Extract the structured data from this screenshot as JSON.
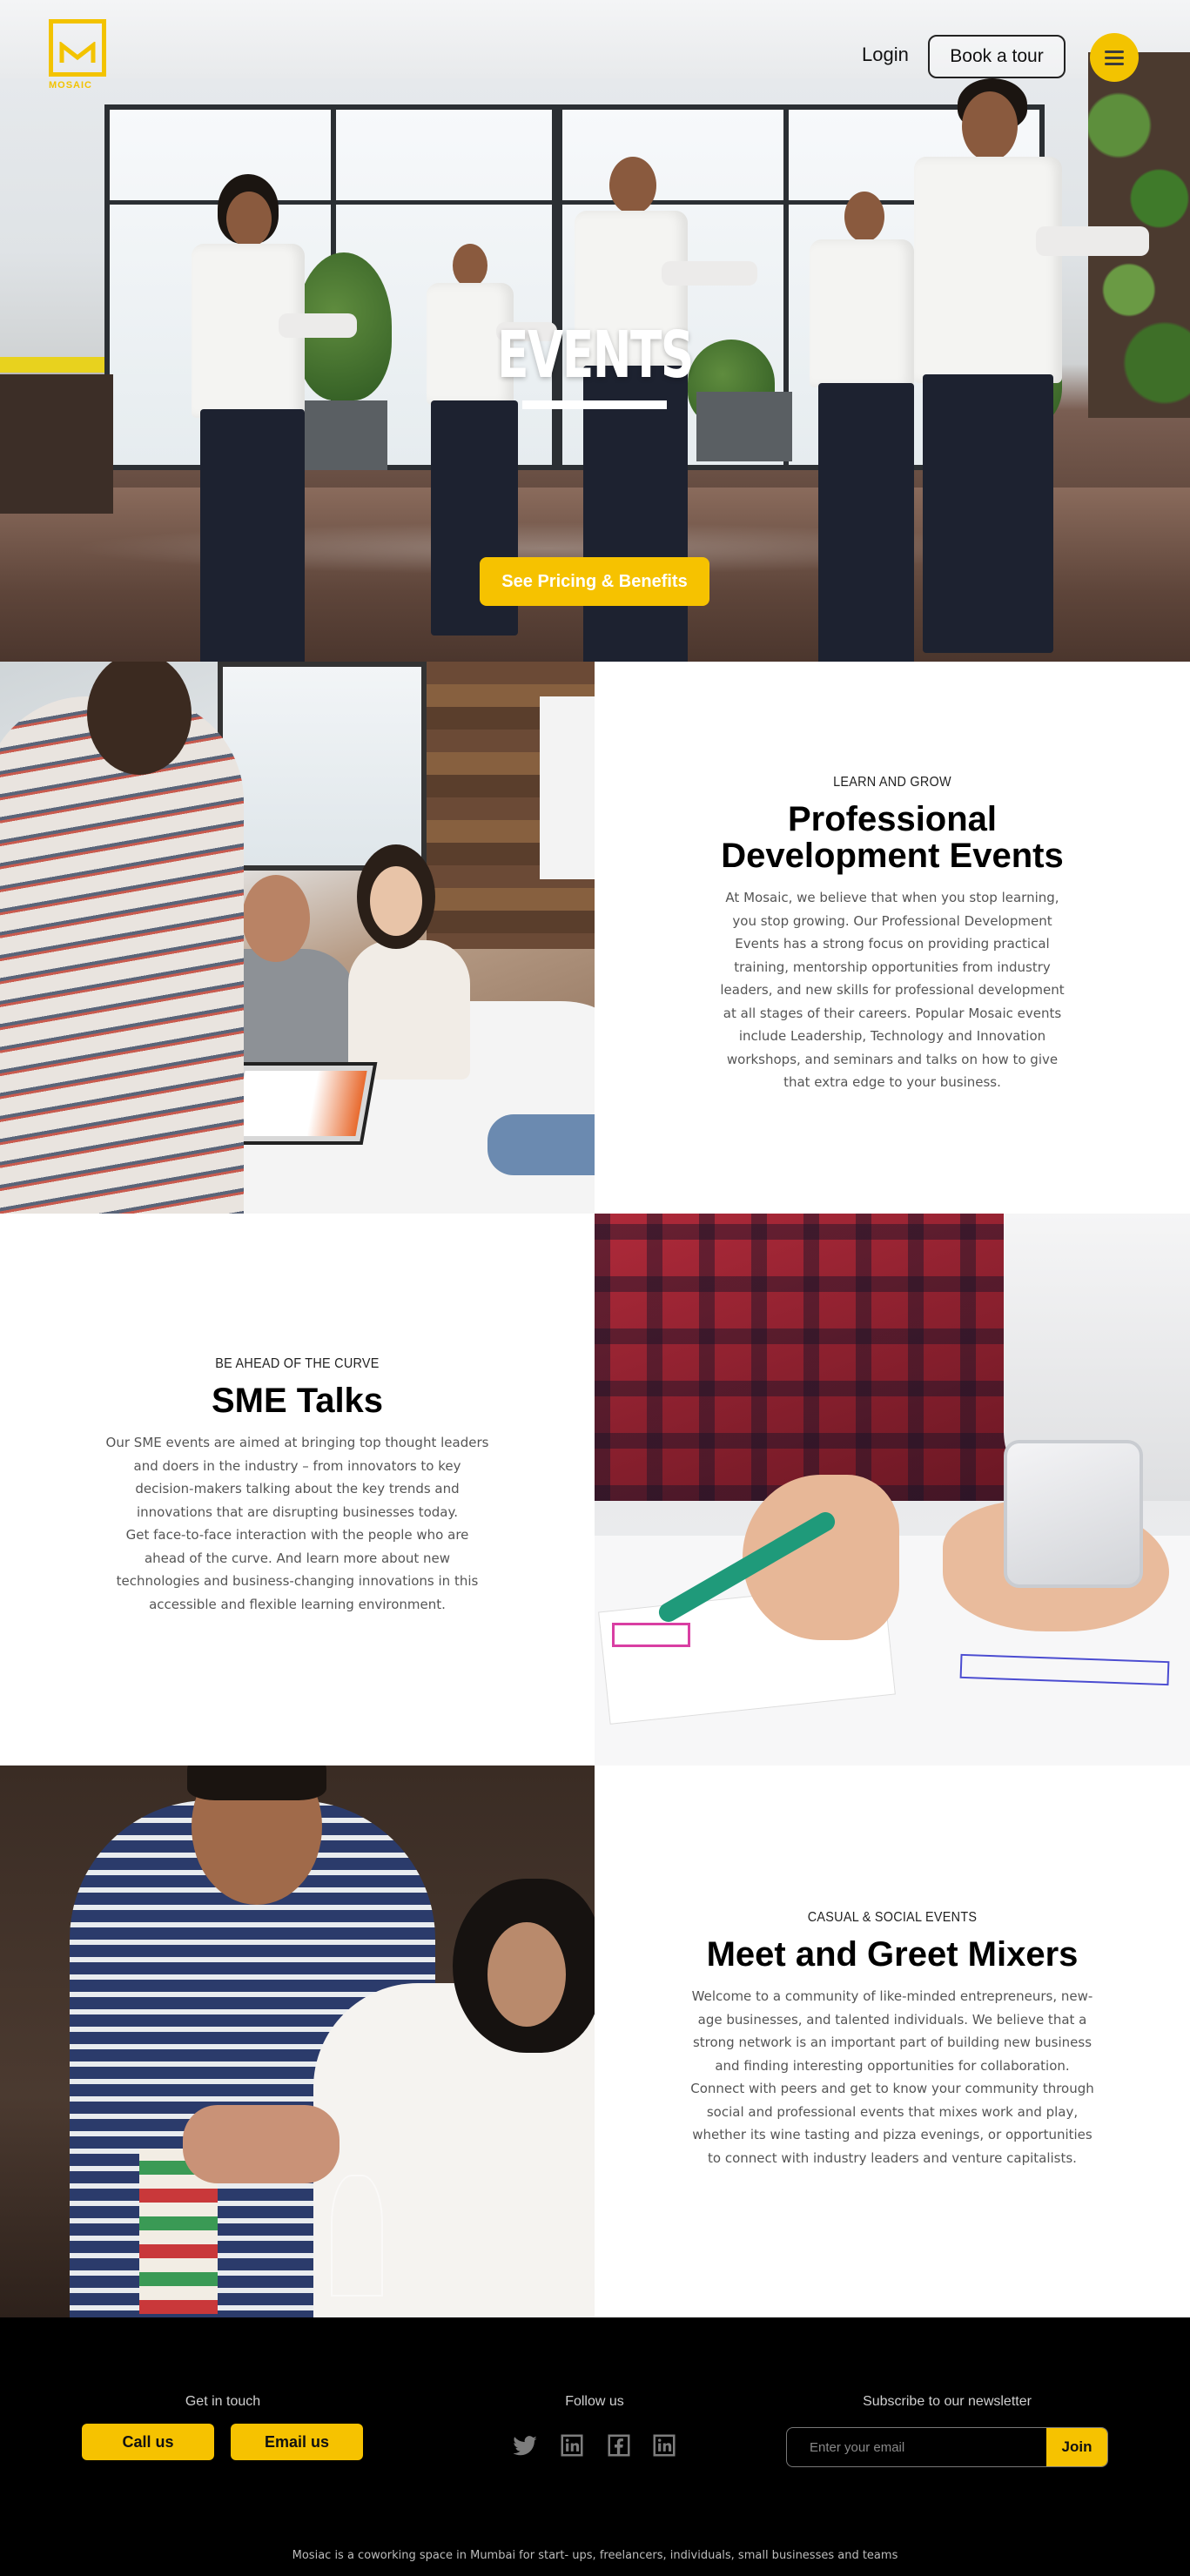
{
  "brand": {
    "logo_text": "MOSAIC",
    "accent_color": "#f6c200"
  },
  "nav": {
    "login_label": "Login",
    "tour_label": "Book a tour",
    "menu_icon": "hamburger-icon"
  },
  "hero": {
    "title": "EVENTS",
    "cta_label": "See Pricing & Benefits"
  },
  "sections": [
    {
      "eyebrow": "LEARN AND GROW",
      "heading_line1": "Professional",
      "heading_line2": "Development Events",
      "body": "At Mosaic, we believe that when you stop learning, you stop growing. Our Professional Development Events has a strong focus on providing practical training, mentorship opportunities from industry leaders, and new skills for professional development at all stages of their careers. Popular Mosaic events include Leadership, Technology and Innovation workshops, and seminars and talks on how to give that extra edge to your business."
    },
    {
      "eyebrow": "BE AHEAD OF THE CURVE",
      "heading": "SME Talks",
      "body_p1": "Our SME events are aimed at bringing top thought leaders and doers in the industry – from innovators to key decision-makers talking about the key trends and innovations that are disrupting businesses today.",
      "body_p2": "Get face-to-face interaction with the people who are ahead of the curve. And learn more about new technologies and business-changing innovations in this accessible and flexible learning environment."
    },
    {
      "eyebrow": "CASUAL & SOCIAL EVENTS",
      "heading": "Meet and Greet Mixers",
      "body": "Welcome to a community of like-minded entrepreneurs, new-age businesses, and talented individuals. We believe that a strong network is an important part of building new business and finding interesting opportunities for collaboration. Connect with peers and get to know your community through social and professional events that mixes work and play, whether its wine tasting and pizza evenings, or opportunities to connect with industry leaders and venture capitalists."
    }
  ],
  "footer": {
    "contact_title": "Get in touch",
    "call_label": "Call us",
    "email_label": "Email us",
    "follow_title": "Follow us",
    "social_icons": [
      "twitter-icon",
      "linkedin-icon",
      "facebook-icon",
      "linkedin-icon"
    ],
    "newsletter_title": "Subscribe to our newsletter",
    "newsletter_placeholder": "Enter your email",
    "join_label": "Join",
    "tagline": "Mosiac is a coworking space in Mumbai for start- ups, freelancers, individuals, small businesses and teams"
  }
}
